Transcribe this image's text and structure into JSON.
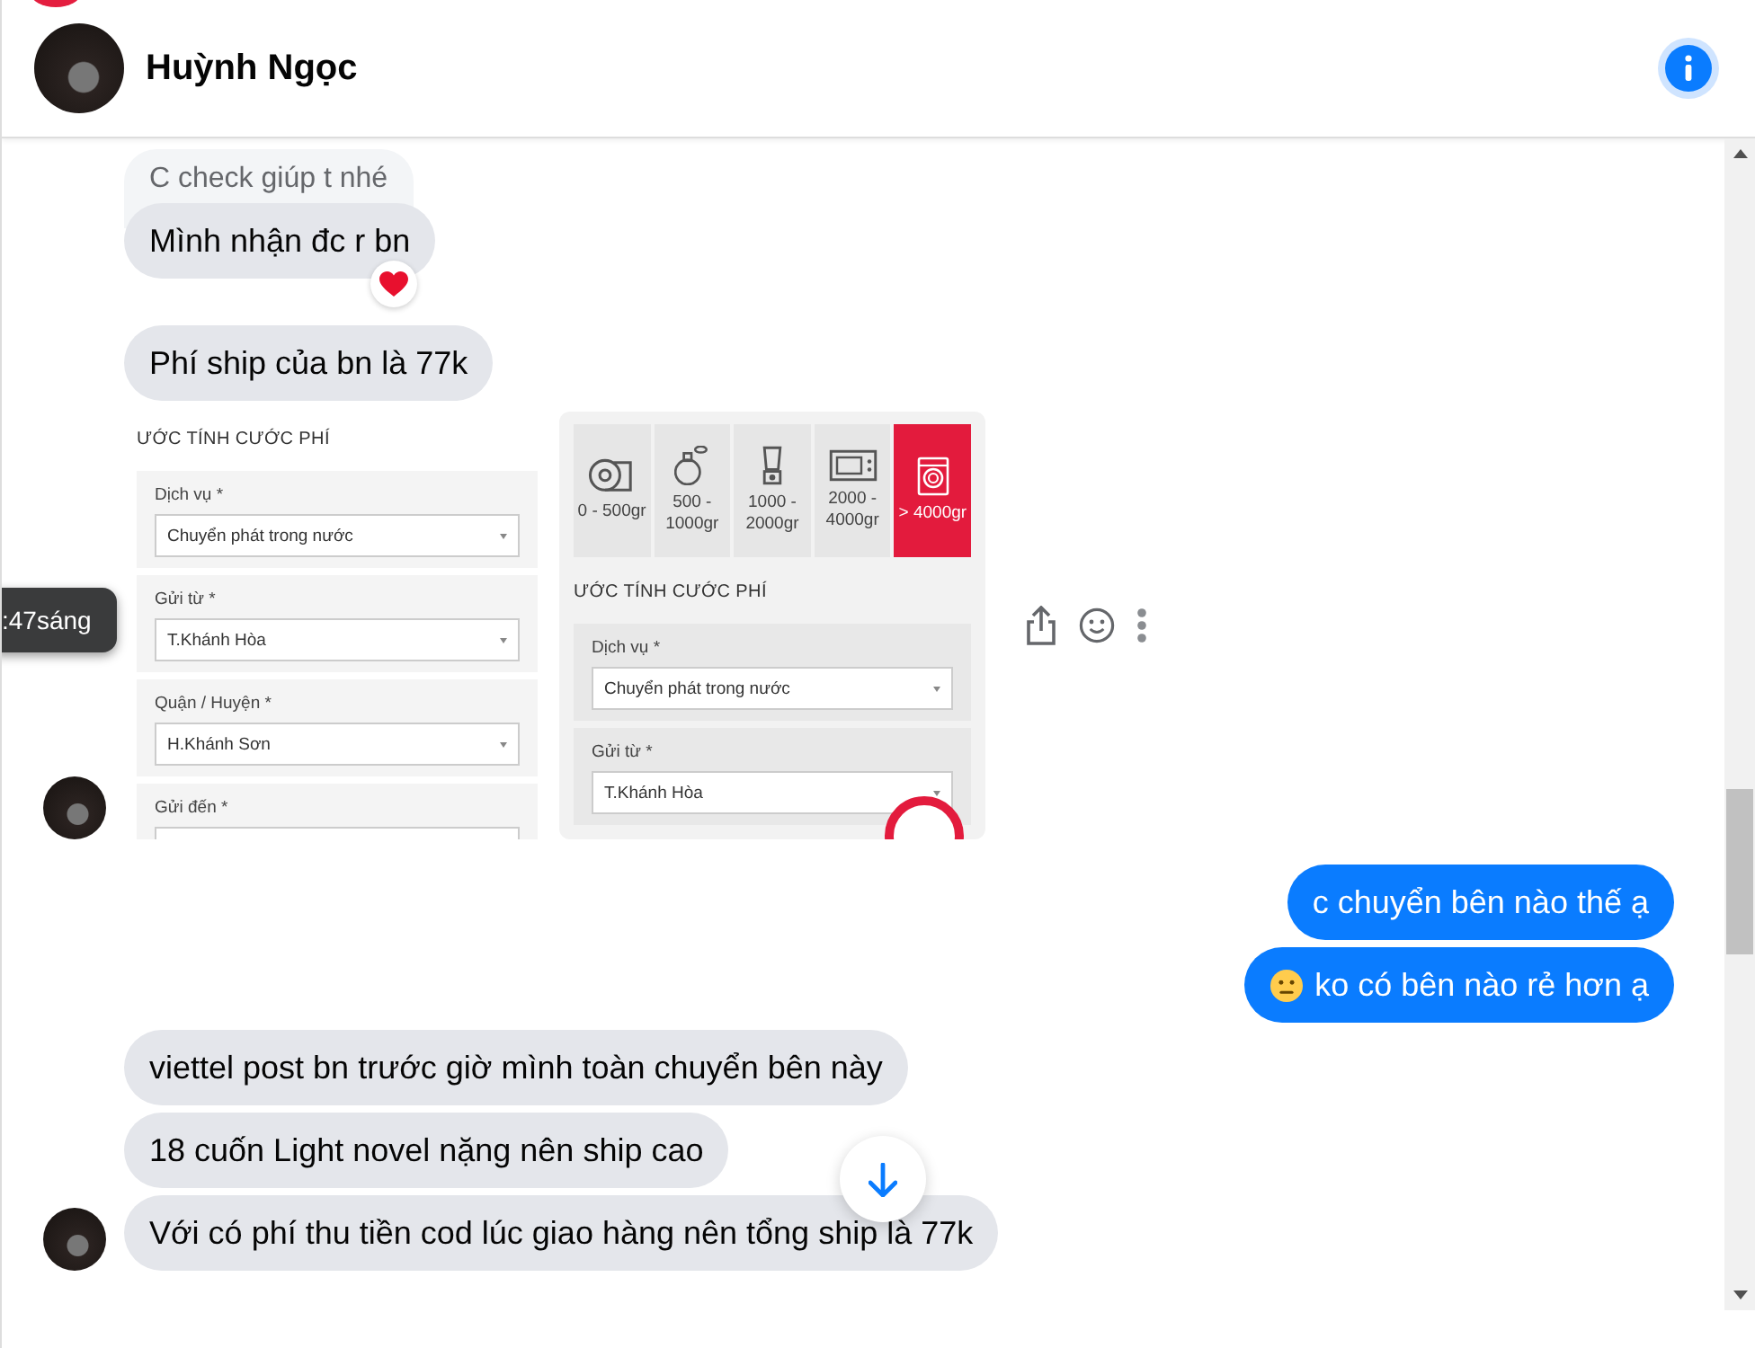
{
  "header": {
    "name": "Huỳnh Ngọc",
    "notification": true
  },
  "messages": [
    {
      "kind": "quote",
      "text": "C check giúp t nhé"
    },
    {
      "kind": "in",
      "text": "Mình nhận đc r bn",
      "reacted": true,
      "avatar": false
    },
    {
      "kind": "in",
      "text": "Phí ship của bn là 77k",
      "reacted": false,
      "avatar": false
    },
    {
      "kind": "images",
      "avatar": true,
      "time": ":47sáng",
      "images": [
        {
          "heading": "ƯỚC TÍNH CƯỚC PHÍ",
          "fields": [
            {
              "label": "Dịch vụ *",
              "value": "Chuyển phát trong nước"
            },
            {
              "label": "Gửi từ *",
              "value": "T.Khánh Hòa"
            },
            {
              "label": "Quận / Huyện *",
              "value": "H.Khánh Sơn"
            },
            {
              "label": "Gửi đến *"
            }
          ]
        },
        {
          "weights": [
            {
              "kind": "roll",
              "label": "0 - 500gr",
              "selected": false
            },
            {
              "kind": "perfume",
              "label": "500 - 1000gr",
              "selected": false
            },
            {
              "kind": "blender",
              "label": "1000 - 2000gr",
              "selected": false
            },
            {
              "kind": "microwave",
              "label": "2000 - 4000gr",
              "selected": false
            },
            {
              "kind": "washer",
              "label": "> 4000gr",
              "selected": true
            }
          ],
          "heading": "ƯỚC TÍNH CƯỚC PHÍ",
          "fields": [
            {
              "label": "Dịch vụ *",
              "value": "Chuyển phát trong nước"
            },
            {
              "label": "Gửi từ *",
              "value": "T.Khánh Hòa"
            }
          ]
        }
      ]
    },
    {
      "kind": "out",
      "text": "c chuyển bên nào thế ạ",
      "emoji": false
    },
    {
      "kind": "out",
      "text": "ko có bên nào rẻ hơn ạ",
      "emoji": true
    },
    {
      "kind": "in",
      "text": "viettel post bn trước giờ mình toàn chuyển bên này",
      "reacted": false,
      "avatar": false
    },
    {
      "kind": "in",
      "text": "18 cuốn Light novel nặng nên ship cao",
      "reacted": false,
      "avatar": false
    },
    {
      "kind": "in",
      "text": "Với có phí thu tiền cod lúc giao hàng nên tổng ship là 77k",
      "reacted": false,
      "avatar": true
    }
  ]
}
